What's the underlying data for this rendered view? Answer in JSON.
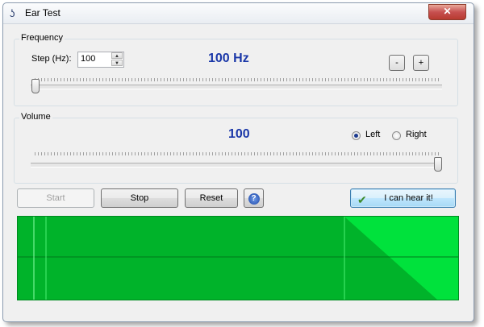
{
  "window": {
    "title": "Ear Test",
    "close_glyph": "✕",
    "icon": "ear-icon"
  },
  "frequency": {
    "group_label": "Frequency",
    "step_label": "Step (Hz):",
    "step_value": "100",
    "display": "100 Hz",
    "minus_label": "-",
    "plus_label": "+",
    "slider_level": 0.0
  },
  "volume": {
    "group_label": "Volume",
    "display": "100",
    "left_label": "Left",
    "right_label": "Right",
    "selected_channel": "Left",
    "slider_level": 1.0
  },
  "buttons": {
    "start": "Start",
    "stop": "Stop",
    "reset": "Reset",
    "help_glyph": "?",
    "hear": "I can hear it!",
    "hear_glyph": "✔"
  },
  "scope": {
    "background": "#00e23c",
    "trace_color": "#00b32a",
    "border_color": "#008a20"
  },
  "colors": {
    "accent_text": "#1a37a8"
  }
}
